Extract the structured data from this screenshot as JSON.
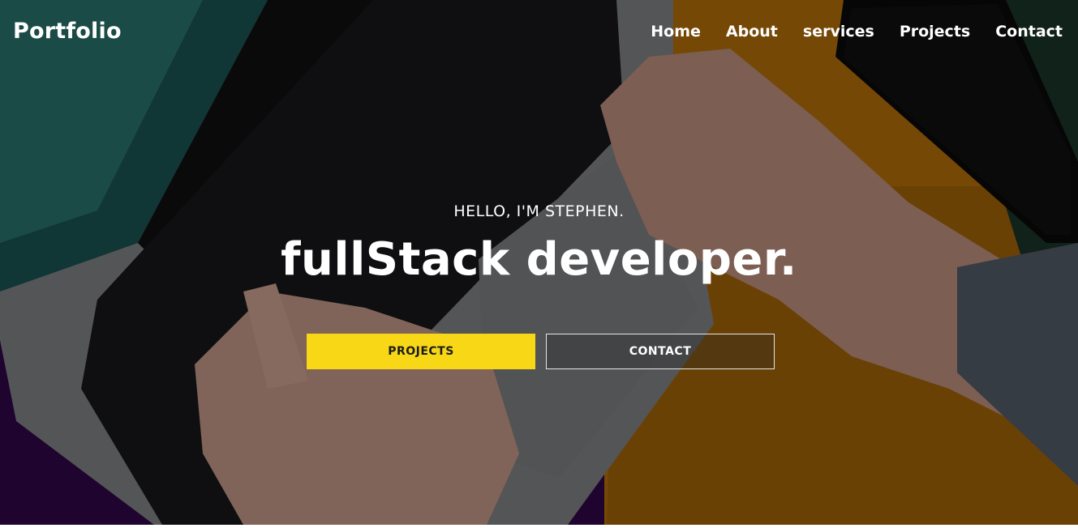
{
  "nav": {
    "brand": "Portfolio",
    "links": [
      "Home",
      "About",
      "services",
      "Projects",
      "Contact"
    ]
  },
  "hero": {
    "greeting": "HELLO, I'M STEPHEN.",
    "headline": "fullStack developer.",
    "primary_button": "PROJECTS",
    "secondary_button": "CONTACT"
  },
  "colors": {
    "accent": "#f7d716",
    "purple": "#3a0a5c",
    "orange": "#e28d0c"
  },
  "background_image": "laptop-typing-photo"
}
